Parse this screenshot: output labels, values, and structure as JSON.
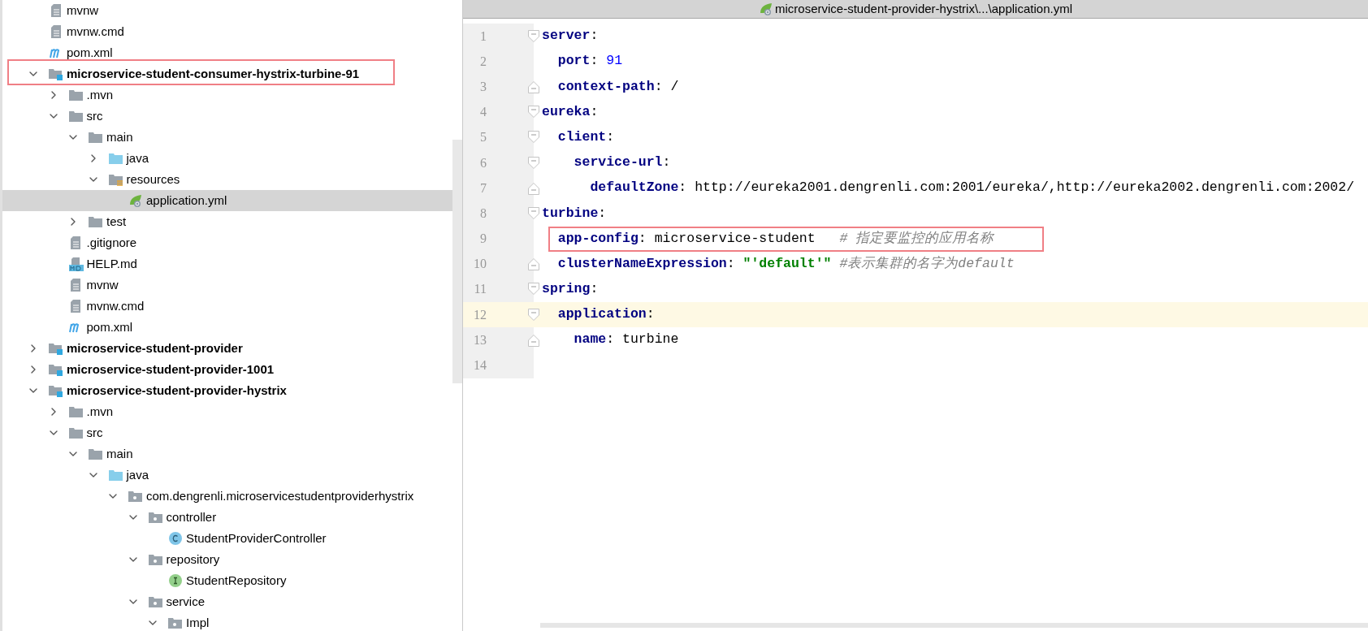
{
  "project_tree": {
    "items": [
      {
        "children": [
          {
            "label": "mvnw",
            "kind": "file",
            "selected": false
          },
          {
            "label": "mvnw.cmd",
            "kind": "file",
            "selected": false
          },
          {
            "label": "pom.xml",
            "kind": "maven",
            "selected": false
          }
        ]
      },
      {
        "label": "microservice-student-consumer-hystrix-turbine-91",
        "kind": "module",
        "expanded": true,
        "selected": false,
        "annotated": true,
        "children": [
          {
            "label": ".mvn",
            "kind": "folder",
            "expanded": false,
            "selected": false
          },
          {
            "label": "src",
            "kind": "folder",
            "expanded": true,
            "selected": false,
            "children": [
              {
                "label": "main",
                "kind": "folder",
                "expanded": true,
                "selected": false,
                "children": [
                  {
                    "label": "java",
                    "kind": "source-folder",
                    "expanded": false,
                    "selected": false
                  },
                  {
                    "label": "resources",
                    "kind": "resources-folder",
                    "expanded": true,
                    "selected": false,
                    "children": [
                      {
                        "label": "application.yml",
                        "kind": "yaml",
                        "selected": true
                      }
                    ]
                  }
                ]
              },
              {
                "label": "test",
                "kind": "folder",
                "expanded": false,
                "selected": false
              }
            ]
          },
          {
            "label": ".gitignore",
            "kind": "file",
            "selected": false
          },
          {
            "label": "HELP.md",
            "kind": "markdown",
            "selected": false
          },
          {
            "label": "mvnw",
            "kind": "file",
            "selected": false
          },
          {
            "label": "mvnw.cmd",
            "kind": "file",
            "selected": false
          },
          {
            "label": "pom.xml",
            "kind": "maven",
            "selected": false
          }
        ]
      },
      {
        "label": "microservice-student-provider",
        "kind": "module",
        "expanded": false,
        "selected": false
      },
      {
        "label": "microservice-student-provider-1001",
        "kind": "module",
        "expanded": false,
        "selected": false
      },
      {
        "label": "microservice-student-provider-hystrix",
        "kind": "module",
        "expanded": true,
        "selected": false,
        "children": [
          {
            "label": ".mvn",
            "kind": "folder",
            "expanded": false,
            "selected": false
          },
          {
            "label": "src",
            "kind": "folder",
            "expanded": true,
            "selected": false,
            "children": [
              {
                "label": "main",
                "kind": "folder",
                "expanded": true,
                "selected": false,
                "children": [
                  {
                    "label": "java",
                    "kind": "source-folder",
                    "expanded": true,
                    "selected": false,
                    "children": [
                      {
                        "label": "com.dengrenli.microservicestudentproviderhystrix",
                        "kind": "package",
                        "expanded": true,
                        "selected": false,
                        "children": [
                          {
                            "label": "controller",
                            "kind": "package",
                            "expanded": true,
                            "selected": false,
                            "children": [
                              {
                                "label": "StudentProviderController",
                                "kind": "class",
                                "selected": false
                              }
                            ]
                          },
                          {
                            "label": "repository",
                            "kind": "package",
                            "expanded": true,
                            "selected": false,
                            "children": [
                              {
                                "label": "StudentRepository",
                                "kind": "interface",
                                "selected": false
                              }
                            ]
                          },
                          {
                            "label": "service",
                            "kind": "package",
                            "expanded": true,
                            "selected": false,
                            "children": [
                              {
                                "label": "Impl",
                                "kind": "package",
                                "expanded": true,
                                "selected": false
                              }
                            ]
                          }
                        ]
                      }
                    ]
                  }
                ]
              }
            ]
          }
        ]
      }
    ]
  },
  "editor": {
    "title": "microservice-student-provider-hystrix\\...\\application.yml",
    "lines": [
      {
        "number": "1",
        "kind": "fold-start",
        "current": false,
        "annotated": false,
        "tokens": [
          {
            "kind": "key",
            "text": "server"
          },
          {
            "kind": "punct",
            "text": ":"
          }
        ]
      },
      {
        "number": "2",
        "kind": "plain",
        "current": false,
        "annotated": false,
        "tokens": [
          {
            "kind": "key",
            "text": "  port"
          },
          {
            "kind": "punct",
            "text": ": "
          },
          {
            "kind": "number",
            "text": "91"
          }
        ]
      },
      {
        "number": "3",
        "kind": "fold-end",
        "current": false,
        "annotated": false,
        "tokens": [
          {
            "kind": "key",
            "text": "  context-path"
          },
          {
            "kind": "punct",
            "text": ": "
          },
          {
            "kind": "plain",
            "text": "/"
          }
        ]
      },
      {
        "number": "4",
        "kind": "fold-start",
        "current": false,
        "annotated": false,
        "tokens": [
          {
            "kind": "key",
            "text": "eureka"
          },
          {
            "kind": "punct",
            "text": ":"
          }
        ]
      },
      {
        "number": "5",
        "kind": "fold-start",
        "current": false,
        "annotated": false,
        "tokens": [
          {
            "kind": "key",
            "text": "  client"
          },
          {
            "kind": "punct",
            "text": ":"
          }
        ]
      },
      {
        "number": "6",
        "kind": "fold-start",
        "current": false,
        "annotated": false,
        "tokens": [
          {
            "kind": "key",
            "text": "    service-url"
          },
          {
            "kind": "punct",
            "text": ":"
          }
        ]
      },
      {
        "number": "7",
        "kind": "fold-end",
        "current": false,
        "annotated": false,
        "tokens": [
          {
            "kind": "key",
            "text": "      defaultZone"
          },
          {
            "kind": "punct",
            "text": ": "
          },
          {
            "kind": "plain",
            "text": "http://eureka2001.dengrenli.com:2001/eureka/,http://eureka2002.dengrenli.com:2002/"
          }
        ]
      },
      {
        "number": "8",
        "kind": "fold-start",
        "current": false,
        "annotated": false,
        "tokens": [
          {
            "kind": "key",
            "text": "turbine"
          },
          {
            "kind": "punct",
            "text": ":"
          }
        ]
      },
      {
        "number": "9",
        "kind": "plain",
        "current": false,
        "annotated": true,
        "tokens": [
          {
            "kind": "key",
            "text": "  app-config"
          },
          {
            "kind": "punct",
            "text": ": "
          },
          {
            "kind": "plain",
            "text": "microservice-student   "
          },
          {
            "kind": "comment",
            "text": "# 指定要监控的应用名称"
          }
        ]
      },
      {
        "number": "10",
        "kind": "fold-end",
        "current": false,
        "annotated": false,
        "tokens": [
          {
            "kind": "key",
            "text": "  clusterNameExpression"
          },
          {
            "kind": "punct",
            "text": ": "
          },
          {
            "kind": "string",
            "text": "\"'default'\" "
          },
          {
            "kind": "comment",
            "text": "#表示集群的名字为default"
          }
        ]
      },
      {
        "number": "11",
        "kind": "fold-start",
        "current": false,
        "annotated": false,
        "tokens": [
          {
            "kind": "key",
            "text": "spring"
          },
          {
            "kind": "punct",
            "text": ":"
          }
        ]
      },
      {
        "number": "12",
        "kind": "fold-start",
        "current": true,
        "annotated": false,
        "tokens": [
          {
            "kind": "key",
            "text": "  application"
          },
          {
            "kind": "punct",
            "text": ":"
          }
        ]
      },
      {
        "number": "13",
        "kind": "fold-end",
        "current": false,
        "annotated": false,
        "tokens": [
          {
            "kind": "key",
            "text": "    name"
          },
          {
            "kind": "punct",
            "text": ": "
          },
          {
            "kind": "plain",
            "text": "turbine"
          }
        ]
      },
      {
        "number": "14",
        "kind": "plain",
        "current": false,
        "annotated": false
      }
    ]
  }
}
